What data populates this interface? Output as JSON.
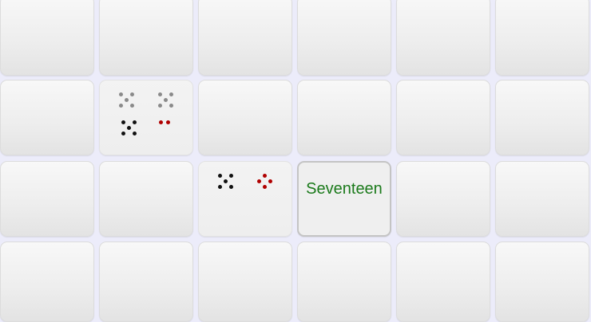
{
  "colors": {
    "background": "#ececfa",
    "word": "#1b7a1b",
    "pip_black": "#111111",
    "pip_gray": "#8a8a8a",
    "pip_red": "#b00000"
  },
  "grid": {
    "rows": 4,
    "cols": 6
  },
  "tiles": [
    {
      "row": 1,
      "col": 1,
      "kind": "dice",
      "dice": [
        {
          "value": 5,
          "color": "gray",
          "pattern": "x"
        },
        {
          "value": 5,
          "color": "gray",
          "pattern": "x"
        },
        {
          "value": 5,
          "color": "black",
          "pattern": "x"
        },
        {
          "value": 2,
          "color": "red",
          "pattern": "h"
        }
      ]
    },
    {
      "row": 2,
      "col": 2,
      "kind": "dice",
      "dice": [
        {
          "value": 5,
          "color": "black",
          "pattern": "x"
        },
        {
          "value": 4,
          "color": "red",
          "pattern": "diamond"
        }
      ]
    },
    {
      "row": 2,
      "col": 3,
      "kind": "word",
      "selected": true,
      "word": "Seventeen"
    }
  ]
}
